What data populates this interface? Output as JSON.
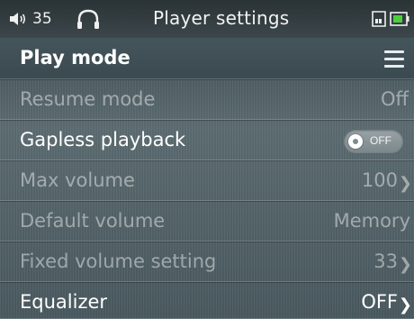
{
  "status_bar": {
    "volume_icon": "speaker-icon",
    "volume_value": "35",
    "headphone_icon": "headphone-icon",
    "title": "Player settings",
    "sd_icon": "sd-card-icon",
    "battery_icon": "battery-icon"
  },
  "section": {
    "title": "Play mode",
    "menu_icon": "hamburger-menu-icon"
  },
  "settings": [
    {
      "label": "Resume mode",
      "value": "Off",
      "enabled": false
    },
    {
      "label": "Gapless playback",
      "toggle_text": "OFF",
      "toggle_on": false,
      "enabled": true
    },
    {
      "label": "Max volume",
      "value": "100",
      "enabled": false,
      "has_chevron": true
    },
    {
      "label": "Default volume",
      "value": "Memory",
      "enabled": false
    },
    {
      "label": "Fixed volume setting",
      "value": "33",
      "enabled": false,
      "has_chevron": true
    },
    {
      "label": "Equalizer",
      "value": "OFF",
      "enabled": true,
      "has_chevron": true
    }
  ],
  "colors": {
    "background_top": "#3b4a50",
    "background_mid": "#5d6d72",
    "text_enabled": "#ffffff",
    "text_disabled": "#a9b1b4",
    "battery_fill": "#4ccf3c"
  }
}
